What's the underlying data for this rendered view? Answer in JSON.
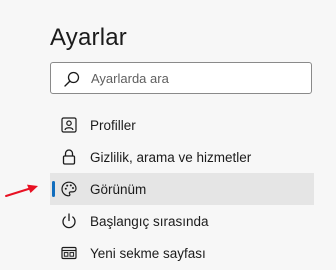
{
  "settings": {
    "title": "Ayarlar",
    "search": {
      "placeholder": "Ayarlarda ara",
      "value": "",
      "icon": "search-icon"
    },
    "nav_items": [
      {
        "label": "Profiller",
        "icon": "profile-card-icon",
        "active": false
      },
      {
        "label": "Gizlilik, arama ve hizmetler",
        "icon": "lock-icon",
        "active": false
      },
      {
        "label": "Görünüm",
        "icon": "palette-icon",
        "active": true
      },
      {
        "label": "Başlangıç sırasında",
        "icon": "power-icon",
        "active": false
      },
      {
        "label": "Yeni sekme sayfası",
        "icon": "new-tab-page-icon",
        "active": false
      }
    ]
  },
  "annotation": {
    "arrow_icon": "red-arrow-icon",
    "arrow_color": "#e81123"
  },
  "colors": {
    "accent": "#0f6cbd",
    "active_background": "#e5e5e5",
    "page_background": "#f7f7f7"
  }
}
